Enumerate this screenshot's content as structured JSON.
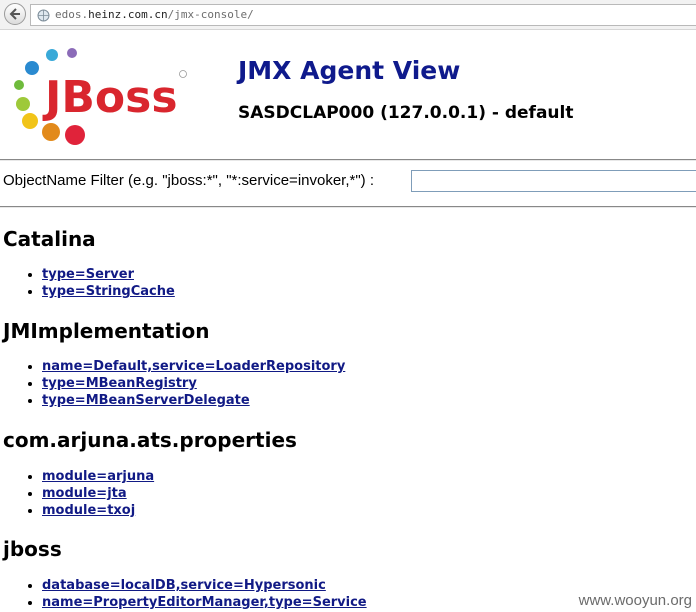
{
  "browser": {
    "url_prefix": "edos.",
    "url_domain": "heinz.com.cn",
    "url_path": "/jmx-console/"
  },
  "header": {
    "title": "JMX Agent View",
    "subtitle": "SASDCLAP000 (127.0.0.1) - default",
    "logo_text": "JBoss"
  },
  "filter": {
    "label": "ObjectName Filter (e.g. \"jboss:*\", \"*:service=invoker,*\") :",
    "value": ""
  },
  "domains": [
    {
      "name": "Catalina",
      "mbeans": [
        "type=Server",
        "type=StringCache"
      ]
    },
    {
      "name": "JMImplementation",
      "mbeans": [
        "name=Default,service=LoaderRepository",
        "type=MBeanRegistry",
        "type=MBeanServerDelegate"
      ]
    },
    {
      "name": "com.arjuna.ats.properties",
      "mbeans": [
        "module=arjuna",
        "module=jta",
        "module=txoj"
      ]
    },
    {
      "name": "jboss",
      "mbeans": [
        "database=localDB,service=Hypersonic",
        "name=PropertyEditorManager,type=Service"
      ]
    }
  ],
  "watermark": "www.wooyun.org",
  "colors": {
    "title": "#0f1a8c",
    "link": "#111a85",
    "logo_red": "#d9262e",
    "logo_gray": "#8c8c8c"
  }
}
